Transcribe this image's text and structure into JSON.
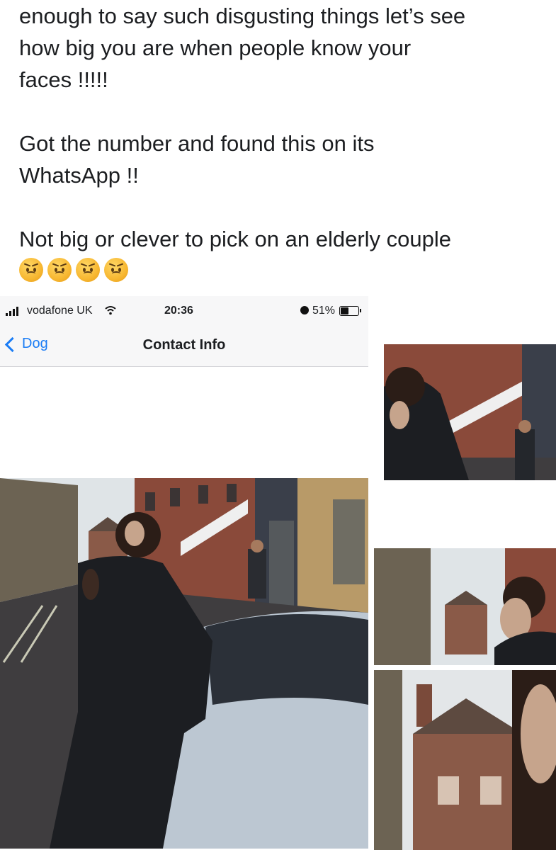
{
  "post": {
    "paragraphs": [
      [
        "enough to say such disgusting things let’s see",
        "how big you are when people know your",
        "faces !!!!!"
      ],
      [
        "Got the number and found this on its",
        "WhatsApp !!"
      ],
      [
        "Not big or clever to pick on an elderly couple"
      ]
    ],
    "emojis": [
      "frowning-face",
      "frowning-face",
      "frowning-face",
      "frowning-face"
    ]
  },
  "phone": {
    "status": {
      "carrier": "vodafone UK",
      "time": "20:36",
      "battery_percent": "51%",
      "battery_level": 0.51
    },
    "nav": {
      "back_label": "Dog",
      "title": "Contact Info"
    }
  },
  "colors": {
    "ios_blue": "#1a7cf5",
    "brick": "#8a4a3a",
    "sky": "#e9eef2"
  }
}
